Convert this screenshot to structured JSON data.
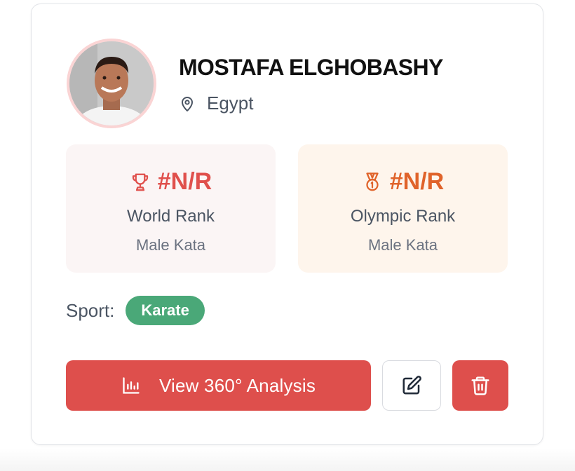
{
  "athlete": {
    "name": "MOSTAFA ELGHOBASHY",
    "country": "Egypt"
  },
  "world_rank": {
    "value": "#N/R",
    "label": "World Rank",
    "category": "Male Kata",
    "icon": "trophy-icon"
  },
  "olympic_rank": {
    "value": "#N/R",
    "label": "Olympic Rank",
    "category": "Male Kata",
    "icon": "medal-icon"
  },
  "sport": {
    "label": "Sport:",
    "value": "Karate"
  },
  "actions": {
    "analysis_label": "View 360° Analysis",
    "analysis_icon": "bar-chart-icon",
    "edit_icon": "edit-icon",
    "delete_icon": "trash-icon"
  },
  "colors": {
    "primary_red": "#de4f4c",
    "olympic_orange": "#e0632a",
    "sport_green": "#4aa878",
    "world_box_bg": "#fbf5f5",
    "olympic_box_bg": "#fef5ec"
  }
}
